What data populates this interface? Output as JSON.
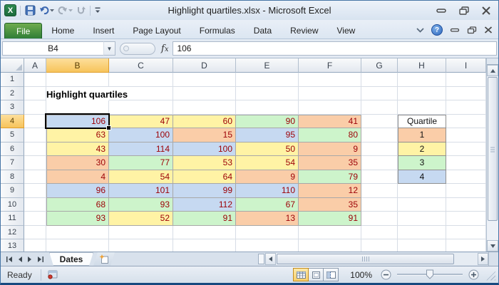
{
  "titlebar": {
    "title": "Highlight quartiles.xlsx  -  Microsoft Excel"
  },
  "ribbon": {
    "file_tab": "File",
    "tabs": [
      "Home",
      "Insert",
      "Page Layout",
      "Formulas",
      "Data",
      "Review",
      "View"
    ]
  },
  "formula_bar": {
    "name_box": "B4",
    "value": "106"
  },
  "sheet": {
    "column_headers": [
      "A",
      "B",
      "C",
      "D",
      "E",
      "F",
      "G",
      "H",
      "I"
    ],
    "row_count": 13,
    "selected_column": "B",
    "selected_row": 4,
    "worksheet_title": "Highlight quartiles",
    "data_table": {
      "start_cell": "B4",
      "columns": [
        "B",
        "C",
        "D",
        "E",
        "F"
      ],
      "rows": [
        4,
        5,
        6,
        7,
        8,
        9,
        10,
        11
      ],
      "values": [
        [
          106,
          47,
          60,
          90,
          41
        ],
        [
          63,
          100,
          15,
          95,
          80
        ],
        [
          43,
          114,
          100,
          50,
          9
        ],
        [
          30,
          77,
          53,
          54,
          35
        ],
        [
          4,
          54,
          64,
          9,
          79
        ],
        [
          96,
          101,
          99,
          110,
          12
        ],
        [
          68,
          93,
          112,
          67,
          35
        ],
        [
          93,
          52,
          91,
          13,
          91
        ]
      ],
      "quartiles": [
        [
          4,
          2,
          2,
          3,
          1
        ],
        [
          2,
          4,
          1,
          4,
          3
        ],
        [
          2,
          4,
          4,
          2,
          1
        ],
        [
          1,
          3,
          2,
          2,
          1
        ],
        [
          1,
          2,
          2,
          1,
          3
        ],
        [
          4,
          4,
          4,
          4,
          1
        ],
        [
          3,
          3,
          4,
          3,
          1
        ],
        [
          3,
          2,
          3,
          1,
          3
        ]
      ]
    },
    "legend": {
      "column": "H",
      "header_row": 4,
      "header": "Quartile",
      "items": [
        "1",
        "2",
        "3",
        "4"
      ]
    }
  },
  "colors": {
    "quartile1": "#FACDA8",
    "quartile2": "#FFF3A5",
    "quartile3": "#CDF4CB",
    "quartile4": "#C6D9F1",
    "value_text": "#9C0006",
    "selected_header": "#F7C45B"
  },
  "sheet_tabs": {
    "active_tab": "Dates"
  },
  "status_bar": {
    "mode": "Ready",
    "zoom_level": "100%"
  }
}
